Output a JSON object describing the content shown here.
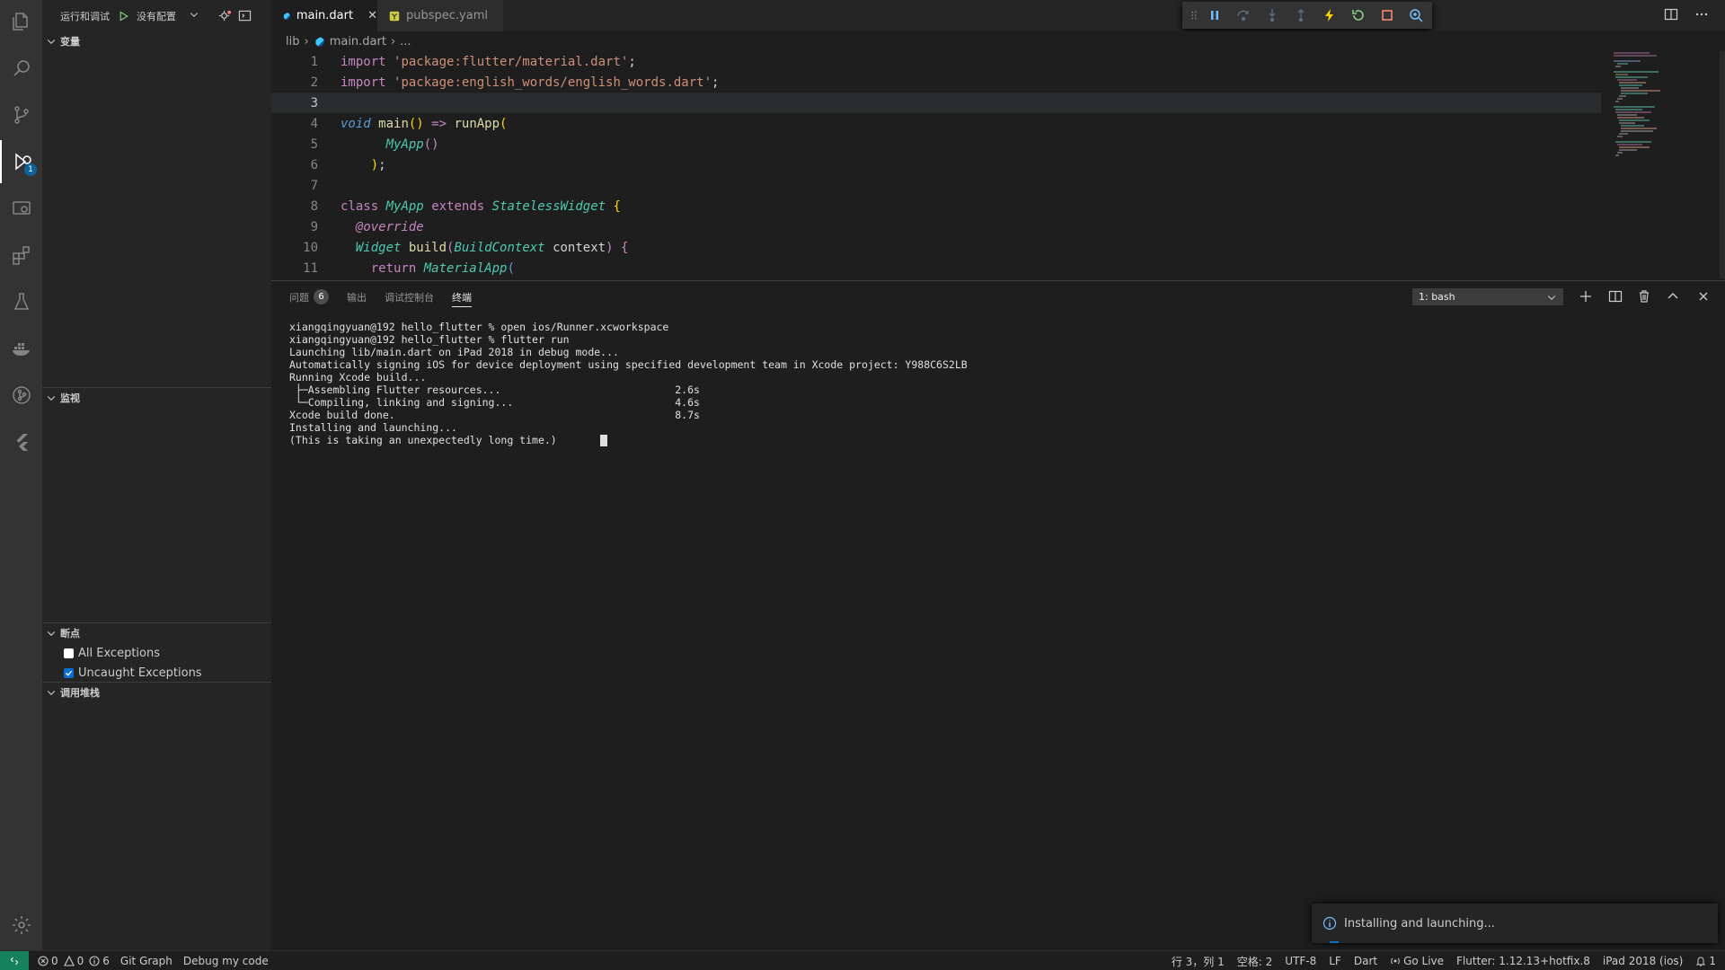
{
  "sidebar": {
    "run_debug_label": "运行和调试",
    "config_label": "没有配置",
    "sections": {
      "variables": "变量",
      "watch": "监视",
      "breakpoints": "断点",
      "callstack": "调用堆栈"
    },
    "breakpoints": [
      {
        "label": "All Exceptions",
        "checked": false
      },
      {
        "label": "Uncaught Exceptions",
        "checked": true
      }
    ]
  },
  "activity": {
    "debug_badge": "1"
  },
  "tabs": [
    {
      "label": "main.dart",
      "active": true
    },
    {
      "label": "pubspec.yaml",
      "active": false
    }
  ],
  "breadcrumb": [
    "lib",
    "main.dart",
    "..."
  ],
  "editor": {
    "line_numbers": [
      "1",
      "2",
      "3",
      "4",
      "5",
      "6",
      "7",
      "8",
      "9",
      "10",
      "11"
    ]
  },
  "panel": {
    "tabs": {
      "problems": "问题",
      "problems_count": "6",
      "output": "输出",
      "debug_console": "调试控制台",
      "terminal": "终端"
    },
    "terminal_select": "1: bash",
    "terminal_lines": [
      "xiangqingyuan@192 hello_flutter % open ios/Runner.xcworkspace",
      "xiangqingyuan@192 hello_flutter % flutter run",
      "Launching lib/main.dart on iPad 2018 in debug mode...",
      "Automatically signing iOS for device deployment using specified development team in Xcode project: Y988C6S2LB",
      "Running Xcode build...",
      " ├─Assembling Flutter resources...                            2.6s",
      " └─Compiling, linking and signing...                          4.6s",
      "Xcode build done.                                             8.7s",
      "Installing and launching...",
      "(This is taking an unexpectedly long time.)       "
    ]
  },
  "notification": {
    "text": "Installing and launching..."
  },
  "statusbar": {
    "errors": "0",
    "warnings": "0",
    "infos": "6",
    "git_graph": "Git Graph",
    "debug_my_code": "Debug my code",
    "position": "行 3，列 1",
    "spaces": "空格: 2",
    "encoding": "UTF-8",
    "eol": "LF",
    "language": "Dart",
    "go_live": "Go Live",
    "flutter": "Flutter: 1.12.13+hotfix.8",
    "device": "iPad 2018 (ios)",
    "notifications": "1"
  },
  "colors": {
    "accent": "#0e639c",
    "remote": "#16825d",
    "debug_continue": "#75beff",
    "debug_restart": "#89d185",
    "debug_stop": "#f48771",
    "hot_reload": "#ffd700"
  },
  "icons": [
    "files-icon",
    "search-icon",
    "source-control-icon",
    "debug-icon",
    "remote-explorer-icon",
    "extensions-icon",
    "testing-icon",
    "docker-icon",
    "git-graph-icon",
    "flutter-icon",
    "settings-gear-icon"
  ]
}
